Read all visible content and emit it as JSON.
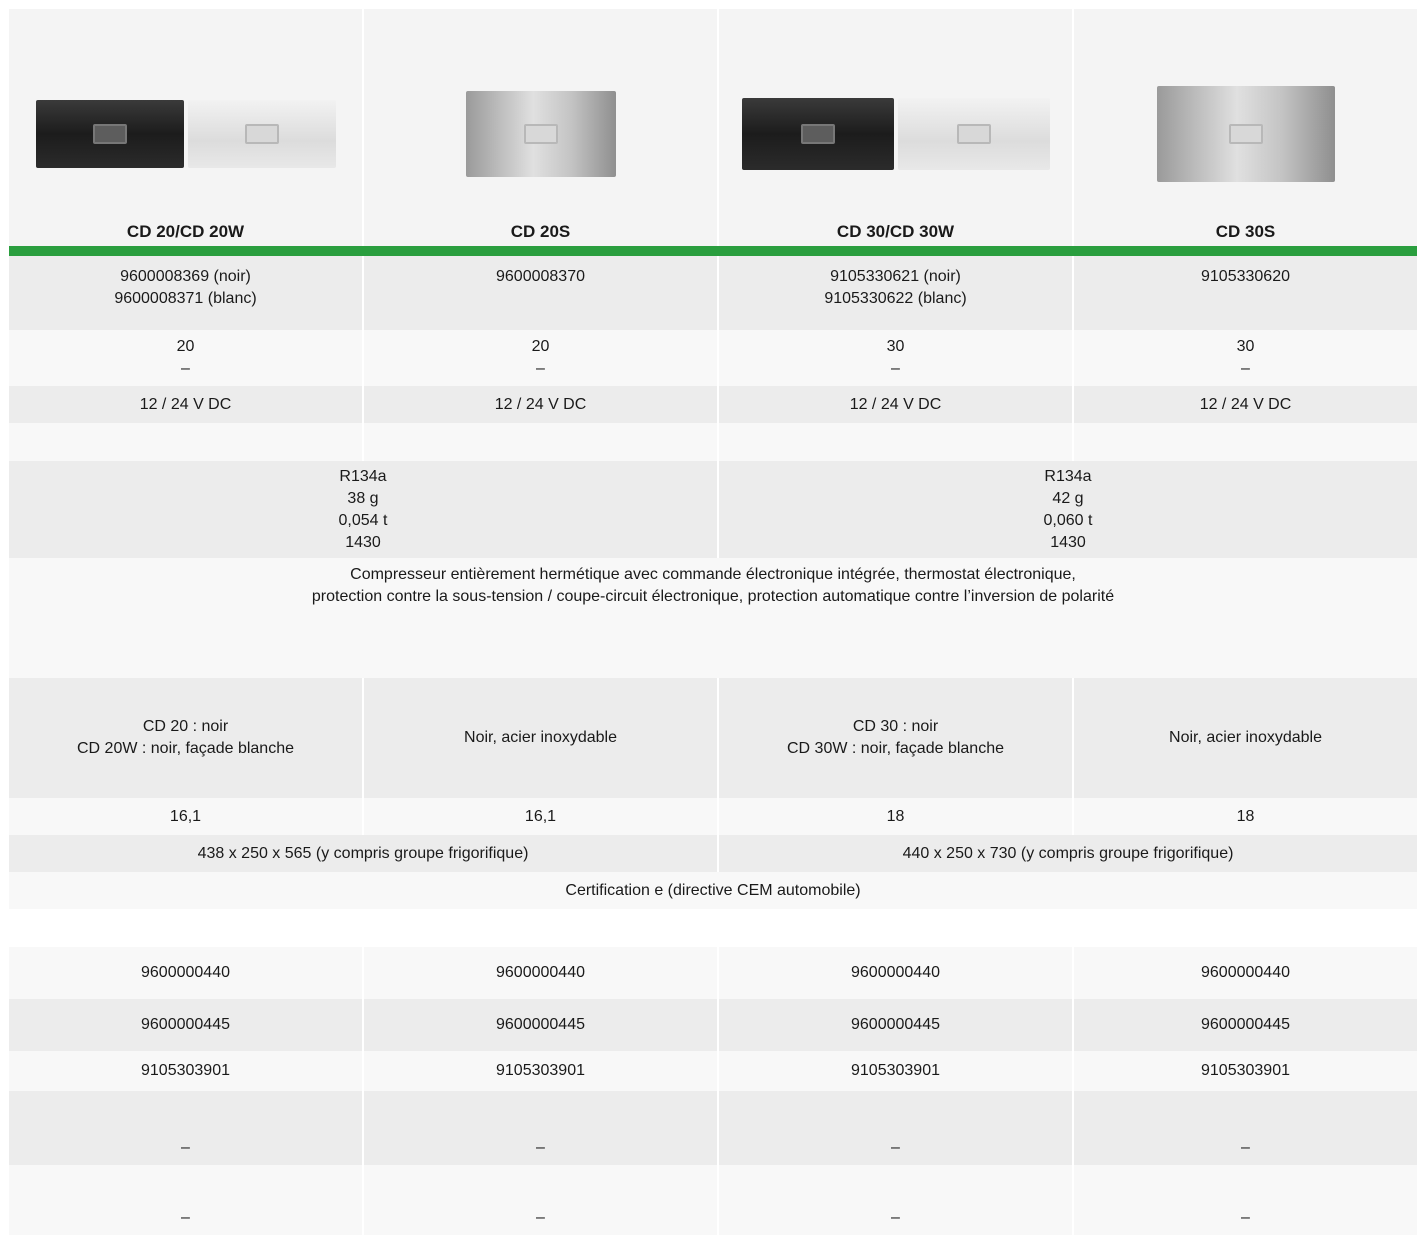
{
  "products": [
    {
      "name": "CD 20/CD 20W",
      "image": "fridge-black-white"
    },
    {
      "name": "CD 20S",
      "image": "fridge-steel"
    },
    {
      "name": "CD 30/CD 30W",
      "image": "fridge-black-white"
    },
    {
      "name": "CD 30S",
      "image": "fridge-steel"
    }
  ],
  "article_numbers": [
    [
      "9600008369 (noir)",
      "9600008371 (blanc)"
    ],
    [
      "9600008370"
    ],
    [
      "9105330621 (noir)",
      "9105330622 (blanc)"
    ],
    [
      "9105330620"
    ]
  ],
  "volume": [
    [
      "20",
      "–"
    ],
    [
      "20",
      "–"
    ],
    [
      "30",
      "–"
    ],
    [
      "30",
      "–"
    ]
  ],
  "voltage": [
    "12 / 24 V DC",
    "12 / 24 V DC",
    "12 / 24 V DC",
    "12 / 24 V DC"
  ],
  "refrigerant": [
    [
      "R134a",
      "38 g",
      "0,054 t",
      "1430"
    ],
    [
      "R134a",
      "42 g",
      "0,060 t",
      "1430"
    ]
  ],
  "compressor": [
    "Compresseur entièrement hermétique avec commande électronique intégrée, thermostat électronique,",
    "protection contre la sous-tension / coupe-circuit électronique, protection automatique contre l’inversion de polarité"
  ],
  "colors": [
    [
      "CD 20 : noir",
      "CD 20W : noir, façade blanche"
    ],
    [
      "Noir, acier inoxydable"
    ],
    [
      "CD 30 : noir",
      "CD 30W : noir, façade blanche"
    ],
    [
      "Noir, acier inoxydable"
    ]
  ],
  "weight": [
    "16,1",
    "16,1",
    "18",
    "18"
  ],
  "dimensions": [
    "438 x 250 x 565 (y compris groupe frigorifique)",
    "440 x 250 x 730 (y compris groupe frigorifique)"
  ],
  "certification": "Certification e (directive CEM automobile)",
  "accessories": [
    [
      "9600000440",
      "9600000440",
      "9600000440",
      "9600000440"
    ],
    [
      "9600000445",
      "9600000445",
      "9600000445",
      "9600000445"
    ],
    [
      "9105303901",
      "9105303901",
      "9105303901",
      "9105303901"
    ],
    [
      "–",
      "–",
      "–",
      "–"
    ],
    [
      "–",
      "–",
      "–",
      "–"
    ]
  ],
  "colors_theme": {
    "green_bar": "#2a9e3e",
    "row_grey": "#ececec",
    "row_light": "#f8f8f8"
  }
}
